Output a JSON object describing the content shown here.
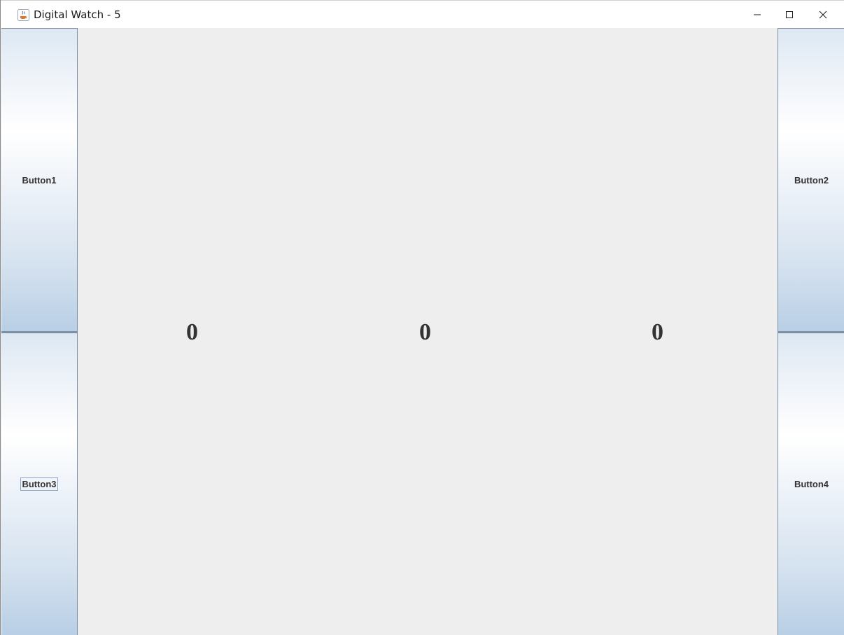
{
  "window": {
    "title": "Digital Watch - 5",
    "icon": "java-cup-icon",
    "controls": [
      "minimize-icon",
      "maximize-icon",
      "close-icon"
    ]
  },
  "buttons": {
    "button1": "Button1",
    "button2": "Button2",
    "button3": "Button3",
    "button4": "Button4"
  },
  "display": {
    "digit1": "0",
    "digit2": "0",
    "digit3": "0"
  },
  "colors": {
    "background": "#eeeeee",
    "text": "#333333",
    "button_gradient_bottom": "#b8cfe5"
  }
}
